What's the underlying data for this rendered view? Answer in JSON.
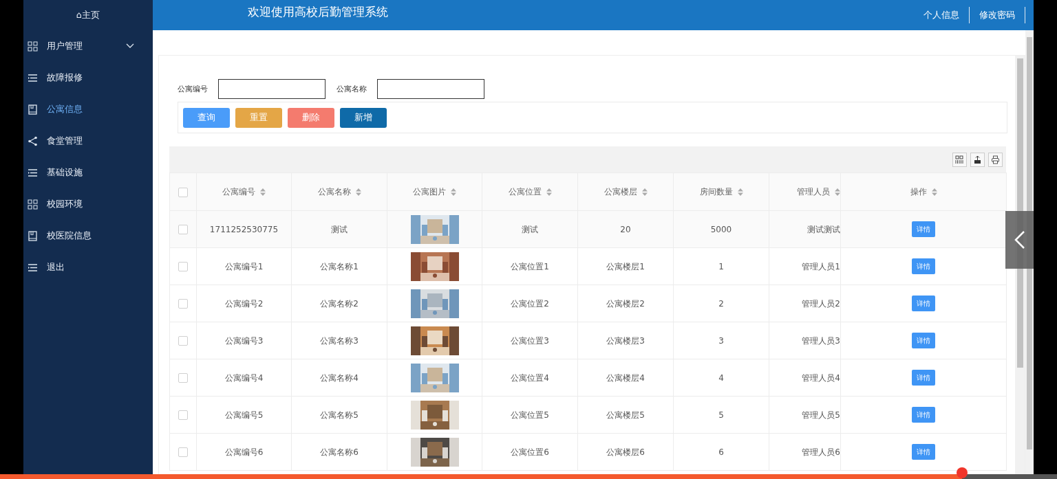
{
  "sidebar": {
    "home": "⌂主页",
    "items": [
      {
        "label": "用户管理",
        "selected": false,
        "has_submenu": true
      },
      {
        "label": "故障报修",
        "selected": false,
        "has_submenu": false
      },
      {
        "label": "公寓信息",
        "selected": true,
        "has_submenu": false
      },
      {
        "label": "食堂管理",
        "selected": false,
        "has_submenu": false
      },
      {
        "label": "基础设施",
        "selected": false,
        "has_submenu": false
      },
      {
        "label": "校园环境",
        "selected": false,
        "has_submenu": false
      },
      {
        "label": "校医院信息",
        "selected": false,
        "has_submenu": false
      },
      {
        "label": "退出",
        "selected": false,
        "has_submenu": false
      }
    ]
  },
  "header": {
    "title": "欢迎使用高校后勤管理系统",
    "links": [
      "个人信息",
      "修改密码"
    ]
  },
  "search": {
    "fields": [
      {
        "label": "公寓编号"
      },
      {
        "label": "公寓名称"
      }
    ],
    "buttons": [
      {
        "label": "查询",
        "color": "#4a9cf9"
      },
      {
        "label": "重置",
        "color": "#e4a646"
      },
      {
        "label": "删除",
        "color": "#f47b6e"
      },
      {
        "label": "新增",
        "color": "#0f6aa8"
      }
    ]
  },
  "table": {
    "header_checked": false,
    "columns": [
      "公寓编号",
      "公寓名称",
      "公寓图片",
      "公寓位置",
      "公寓楼层",
      "房间数量",
      "管理人员",
      "操作"
    ],
    "rows": [
      {
        "checked": false,
        "cells": [
          "1711252530775",
          "测试",
          "",
          "测试",
          "20",
          "5000",
          "测试测试"
        ],
        "action": "详情"
      },
      {
        "checked": false,
        "cells": [
          "公寓编号1",
          "公寓名称1",
          "",
          "公寓位置1",
          "公寓楼层1",
          "1",
          "管理人员1"
        ],
        "action": "详情"
      },
      {
        "checked": false,
        "cells": [
          "公寓编号2",
          "公寓名称2",
          "",
          "公寓位置2",
          "公寓楼层2",
          "2",
          "管理人员2"
        ],
        "action": "详情"
      },
      {
        "checked": false,
        "cells": [
          "公寓编号3",
          "公寓名称3",
          "",
          "公寓位置3",
          "公寓楼层3",
          "3",
          "管理人员3"
        ],
        "action": "详情"
      },
      {
        "checked": false,
        "cells": [
          "公寓编号4",
          "公寓名称4",
          "",
          "公寓位置4",
          "公寓楼层4",
          "4",
          "管理人员4"
        ],
        "action": "详情"
      },
      {
        "checked": false,
        "cells": [
          "公寓编号5",
          "公寓名称5",
          "",
          "公寓位置5",
          "公寓楼层5",
          "5",
          "管理人员5"
        ],
        "action": "详情"
      },
      {
        "checked": false,
        "cells": [
          "公寓编号6",
          "公寓名称6",
          "",
          "公寓位置6",
          "公寓楼层6",
          "6",
          "管理人员6"
        ],
        "action": "详情"
      }
    ]
  },
  "video_progress": {
    "level": 0.91
  }
}
